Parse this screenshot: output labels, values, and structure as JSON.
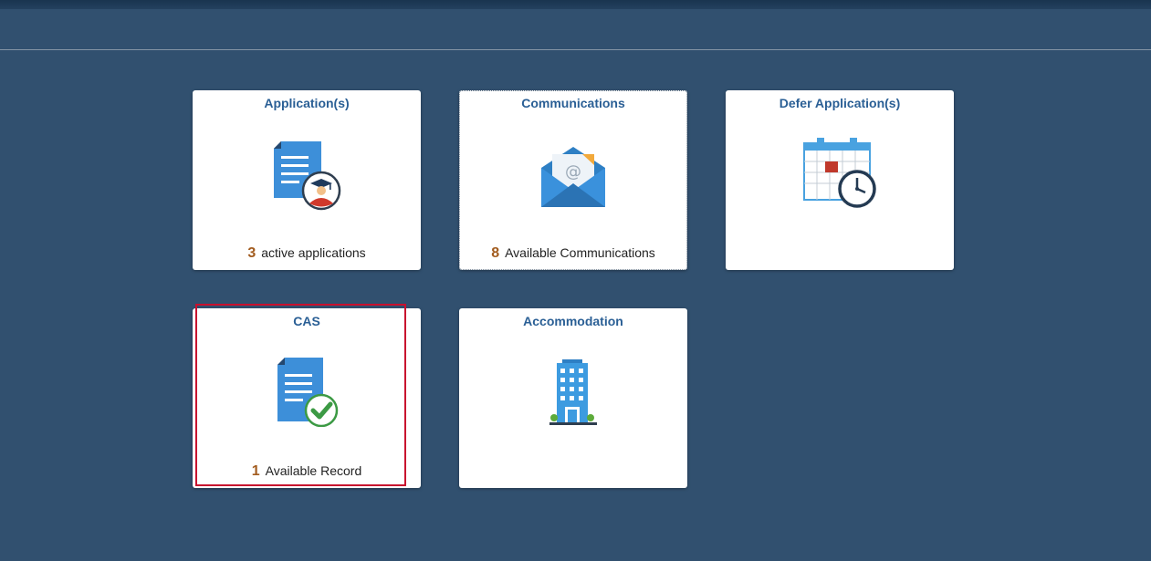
{
  "tiles": [
    {
      "id": "applications",
      "title": "Application(s)",
      "count": "3",
      "label": "active applications",
      "icon": "document-graduate-icon"
    },
    {
      "id": "communications",
      "title": "Communications",
      "count": "8",
      "label": "Available Communications",
      "icon": "envelope-icon"
    },
    {
      "id": "defer",
      "title": "Defer Application(s)",
      "count": "",
      "label": "",
      "icon": "calendar-clock-icon"
    },
    {
      "id": "cas",
      "title": "CAS",
      "count": "1",
      "label": "Available Record",
      "icon": "document-check-icon"
    },
    {
      "id": "accommodation",
      "title": "Accommodation",
      "count": "",
      "label": "",
      "icon": "building-icon"
    }
  ],
  "colors": {
    "background": "#31506f",
    "title": "#2a5f95",
    "count": "#a25c1f",
    "highlight": "#c8102e"
  }
}
